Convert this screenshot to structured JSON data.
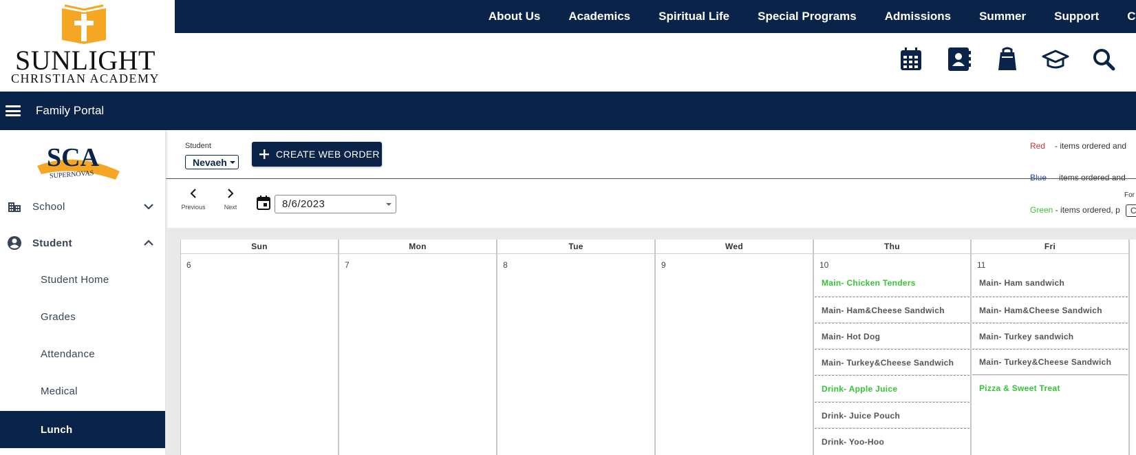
{
  "site": {
    "logo_main": "SUNLIGHT",
    "logo_sub": "CHRISTIAN ACADEMY",
    "nav": [
      "About Us",
      "Academics",
      "Spiritual Life",
      "Special Programs",
      "Admissions",
      "Summer",
      "Support",
      "Cont"
    ],
    "toolbar_icons": [
      "calendar-icon",
      "contacts-icon",
      "bag-icon",
      "graduation-cap-icon",
      "search-icon"
    ],
    "colors": {
      "navy": "#092448",
      "gold": "#f5a623",
      "green": "#35c435",
      "red": "#d32f2f",
      "blue": "#1a3fa8"
    }
  },
  "portal": {
    "title": "Family Portal"
  },
  "sidebar": {
    "logo_text": "SCA",
    "logo_banner": "SUPERNOVAS",
    "sections": [
      {
        "label": "School",
        "icon": "building-icon",
        "expanded": false
      },
      {
        "label": "Student",
        "icon": "account-circle-icon",
        "expanded": true
      }
    ],
    "sub_items": [
      {
        "label": "Student Home"
      },
      {
        "label": "Grades"
      },
      {
        "label": "Attendance"
      },
      {
        "label": "Medical"
      },
      {
        "label": "Lunch",
        "active": true
      }
    ]
  },
  "controls": {
    "student_label": "Student",
    "student_value": "Nevaeh",
    "create_button": "CREATE WEB ORDER",
    "previous": "Previous",
    "next": "Next",
    "date": "8/6/2023",
    "for_label": "For",
    "box_text": "C"
  },
  "legend": [
    {
      "color_name": "Red",
      "text": "- items ordered and"
    },
    {
      "color_name": "Blue",
      "text": "items ordered and"
    },
    {
      "color_name": "Green",
      "text": "- items ordered, p"
    }
  ],
  "calendar": {
    "days": [
      {
        "name": "Sun",
        "date": "6",
        "meals": []
      },
      {
        "name": "Mon",
        "date": "7",
        "meals": []
      },
      {
        "name": "Tue",
        "date": "8",
        "meals": []
      },
      {
        "name": "Wed",
        "date": "9",
        "meals": []
      },
      {
        "name": "Thu",
        "date": "10",
        "meals": [
          {
            "label": "Main- Chicken Tenders",
            "ordered": true
          },
          {
            "label": "Main- Ham&Cheese Sandwich",
            "ordered": false
          },
          {
            "label": "Main- Hot Dog",
            "ordered": false
          },
          {
            "label": "Main- Turkey&Cheese Sandwich",
            "ordered": false
          },
          {
            "label": "Drink- Apple Juice",
            "ordered": true
          },
          {
            "label": "Drink- Juice Pouch",
            "ordered": false
          },
          {
            "label": "Drink- Yoo-Hoo",
            "ordered": false
          }
        ]
      },
      {
        "name": "Fri",
        "date": "11",
        "meals": [
          {
            "label": "Main- Ham sandwich",
            "ordered": false
          },
          {
            "label": "Main- Ham&Cheese Sandwich",
            "ordered": false
          },
          {
            "label": "Main- Turkey sandwich",
            "ordered": false
          },
          {
            "label": "Main- Turkey&Cheese Sandwich",
            "ordered": false
          },
          {
            "label": "Pizza & Sweet Treat",
            "ordered": true
          }
        ]
      }
    ]
  }
}
